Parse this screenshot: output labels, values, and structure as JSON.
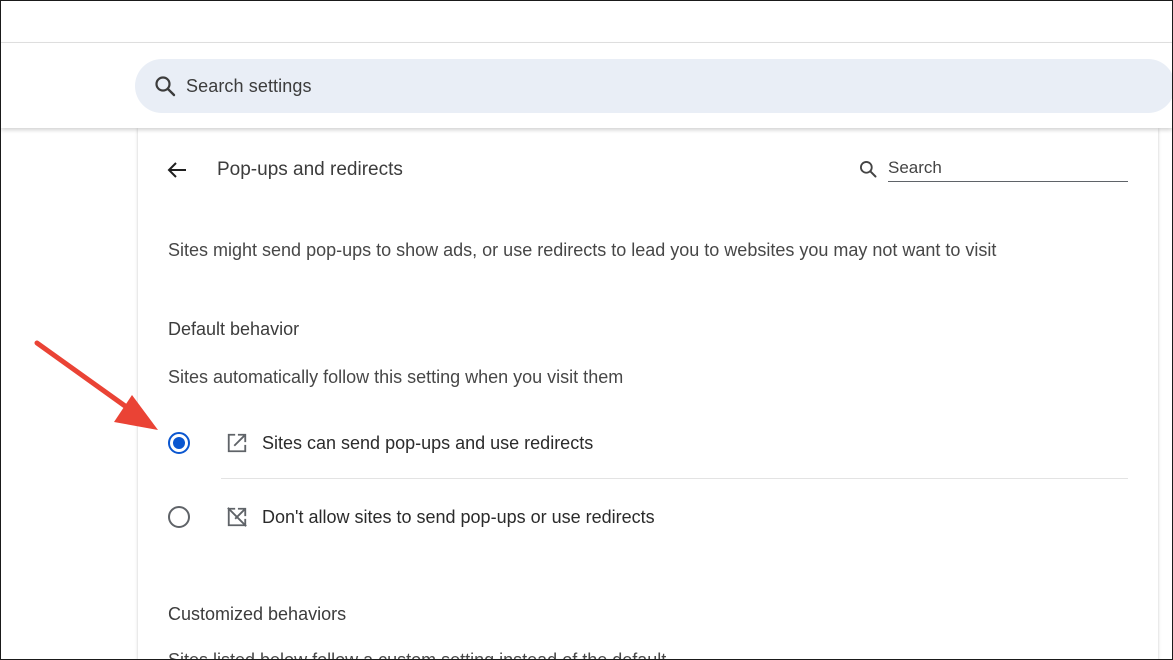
{
  "header": {
    "search_label": "Search settings"
  },
  "page": {
    "title": "Pop-ups and redirects",
    "inline_search_placeholder": "Search",
    "description": "Sites might send pop-ups to show ads, or use redirects to lead you to websites you may not want to visit"
  },
  "default_behavior": {
    "heading": "Default behavior",
    "subtext": "Sites automatically follow this setting when you visit them",
    "options": [
      {
        "label": "Sites can send pop-ups and use redirects",
        "selected": true,
        "icon": "open-in-new-icon"
      },
      {
        "label": "Don't allow sites to send pop-ups or use redirects",
        "selected": false,
        "icon": "block-popups-icon"
      }
    ]
  },
  "customized_behaviors": {
    "heading": "Customized behaviors",
    "subtext": "Sites listed below follow a custom setting instead of the default"
  },
  "colors": {
    "accent": "#0b57d0",
    "search_bg": "#e9eef6",
    "annotation_arrow": "#ea4335"
  }
}
